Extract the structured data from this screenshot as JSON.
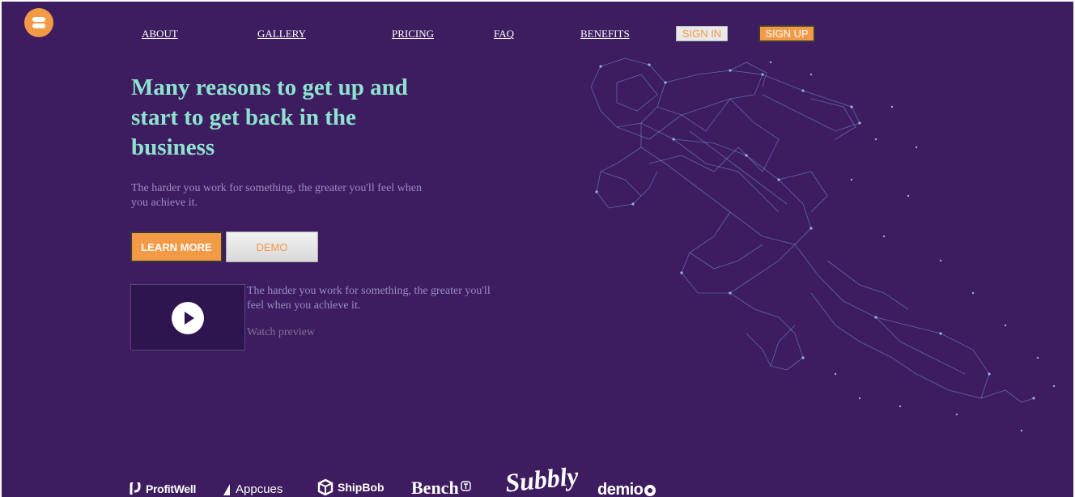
{
  "nav": {
    "items": [
      "ABOUT",
      "GALLERY",
      "PRICING",
      "FAQ",
      "BENEFITS"
    ],
    "sign_in": "SIGN IN",
    "sign_up": "SIGN UP"
  },
  "hero": {
    "headline": "Many reasons to get up and start to get back in the business",
    "subtext": "The harder you work for something, the greater you'll feel when you achieve it.",
    "learn_more": "LEARN MORE",
    "demo": "DEMO"
  },
  "video": {
    "description": "The harder you work for something, the greater you'll feel when you achieve it.",
    "watch_label": "Watch preview"
  },
  "brands": [
    "ProfitWell",
    "Appcues",
    "ShipBob",
    "Bench",
    "Subbly",
    "demio"
  ],
  "colors": {
    "background": "#3d1d5f",
    "accent": "#f39a47",
    "headline": "#8ee3cf",
    "muted_text": "#9a8cc1"
  }
}
